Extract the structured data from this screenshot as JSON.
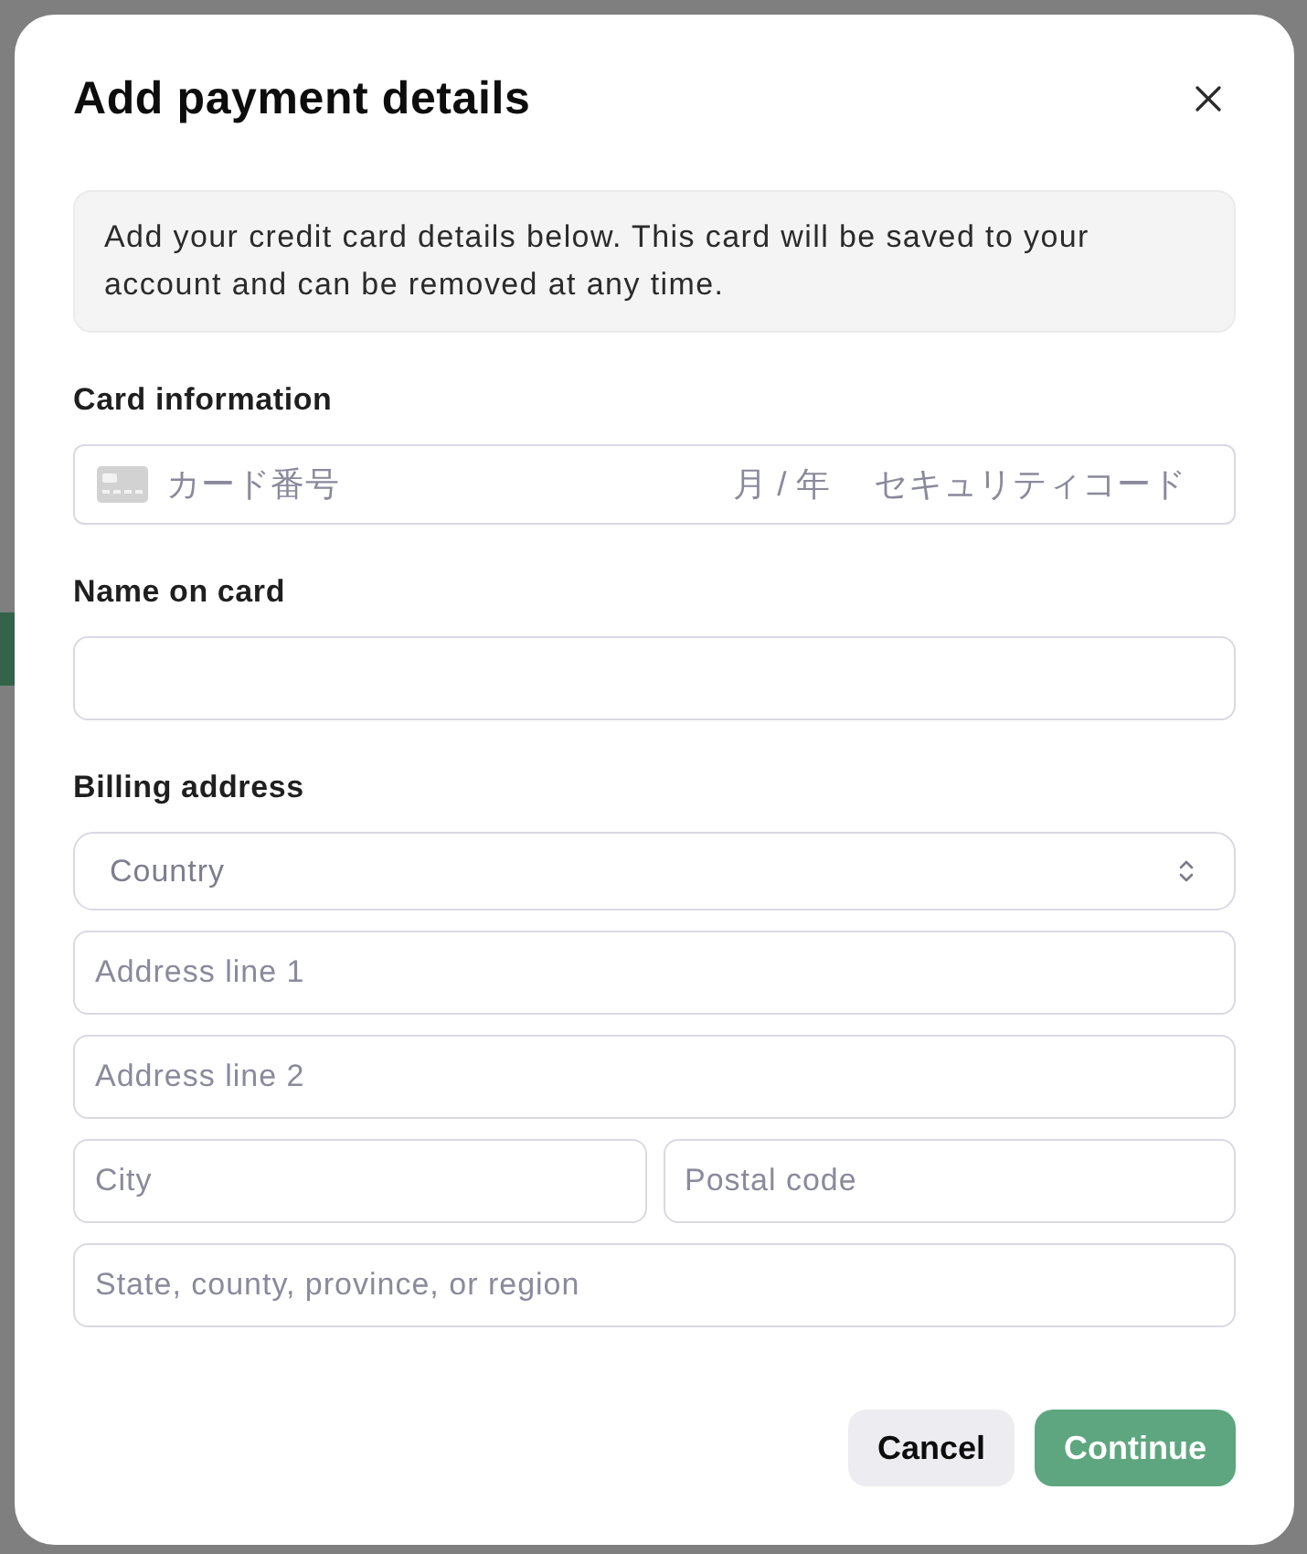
{
  "dialog": {
    "title": "Add payment details",
    "notice": "Add your credit card details below. This card will be saved to your account and can be removed at any time."
  },
  "sections": [
    {
      "kind": "card",
      "label": "Card information",
      "number_placeholder": "カード番号",
      "expiry_placeholder": "月 / 年",
      "cvc_placeholder": "セキュリティコード"
    },
    {
      "kind": "text",
      "label": "Name on card"
    },
    {
      "kind": "address",
      "label": "Billing address",
      "rows": [
        [
          {
            "kind": "select",
            "placeholder": "Country"
          }
        ],
        [
          {
            "kind": "text",
            "placeholder": "Address line 1"
          }
        ],
        [
          {
            "kind": "text",
            "placeholder": "Address line 2"
          }
        ],
        [
          {
            "kind": "text",
            "placeholder": "City"
          },
          {
            "kind": "text",
            "placeholder": "Postal code"
          }
        ],
        [
          {
            "kind": "text",
            "placeholder": "State, county, province, or region"
          }
        ]
      ]
    }
  ],
  "buttons": [
    {
      "label": "Cancel",
      "kind": "secondary"
    },
    {
      "label": "Continue",
      "kind": "primary"
    }
  ]
}
